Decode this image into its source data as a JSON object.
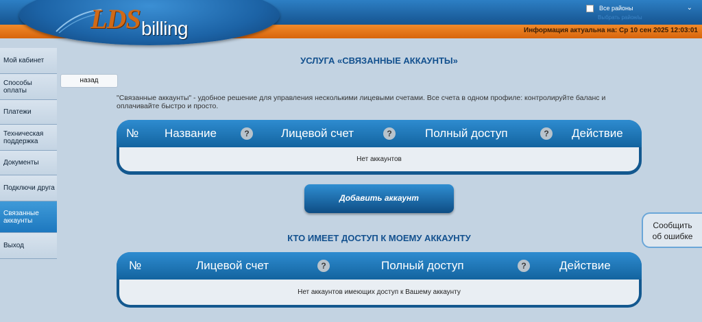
{
  "header": {
    "logo_lds": "LDS",
    "logo_billing": "billing",
    "info": "Информация актуальна на: Ср 10 сен 2025 12:03:01",
    "regions_label": "Все районы",
    "regions_sub": "Выбрать район/ы"
  },
  "sidebar": {
    "items": [
      {
        "label": "Мой кабинет"
      },
      {
        "label": "Способы оплаты"
      },
      {
        "label": "Платежи"
      },
      {
        "label": "Техническая поддержка"
      },
      {
        "label": "Документы"
      },
      {
        "label": "Подключи друга"
      },
      {
        "label": "Связанные аккаунты",
        "active": true
      },
      {
        "label": "Выход"
      }
    ]
  },
  "main": {
    "back_label": "назад",
    "title": "УСЛУГА «СВЯЗАННЫЕ АККАУНТЫ»",
    "description": "\"Связанные аккаунты\" - удобное решение для управления несколькими лицевыми счетами. Все счета в одном профиле: контролируйте баланс и оплачивайте быстро и просто.",
    "table1": {
      "headers": [
        "№",
        "Название",
        "Лицевой счет",
        "Полный доступ",
        "Действие"
      ],
      "help": "?",
      "empty": "Нет аккаунтов"
    },
    "add_button": "Добавить аккаунт",
    "title2": "КТО ИМЕЕТ ДОСТУП К МОЕМУ АККАУНТУ",
    "table2": {
      "headers": [
        "№",
        "Лицевой счет",
        "Полный доступ",
        "Действие"
      ],
      "help": "?",
      "empty": "Нет аккаунтов имеющих доступ к Вашему аккаунту"
    }
  },
  "report": {
    "line1": "Сообщить",
    "line2": "об ошибке"
  },
  "colors": {
    "accent": "#1d78bf",
    "orange": "#e0701a",
    "background": "#c3d3e2"
  }
}
